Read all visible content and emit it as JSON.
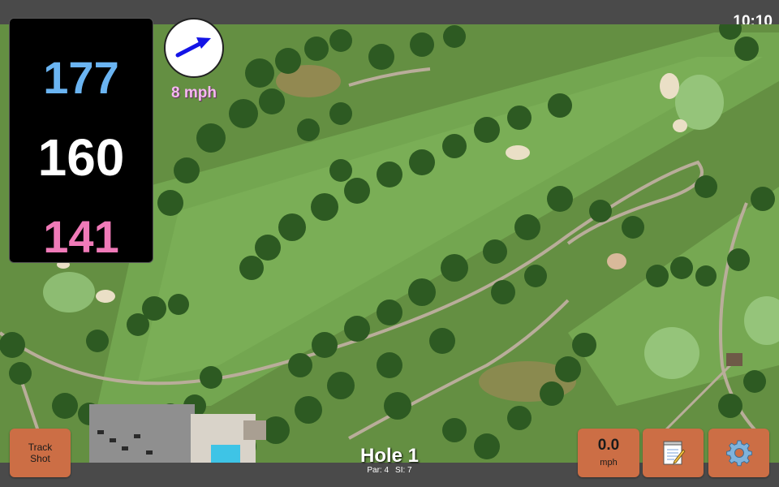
{
  "status_bar": {
    "time": "10:10"
  },
  "distances": {
    "back": "177",
    "center": "160",
    "front": "141"
  },
  "wind": {
    "speed": "8 mph",
    "direction_icon": "arrow-icon"
  },
  "hole": {
    "title": "Hole 1",
    "par": "Par: 4",
    "si": "SI: 7"
  },
  "buttons": {
    "track_shot_line1": "Track",
    "track_shot_line2": "Shot",
    "speed_value": "0.0",
    "speed_unit": "mph",
    "notes_icon": "notepad-icon",
    "settings_icon": "gear-icon"
  },
  "colors": {
    "button_bg": "#cc6e45",
    "back_distance": "#6ab4f2",
    "center_distance": "#ffffff",
    "front_distance": "#f07ab8",
    "wind_text": "#f5b8f0"
  }
}
